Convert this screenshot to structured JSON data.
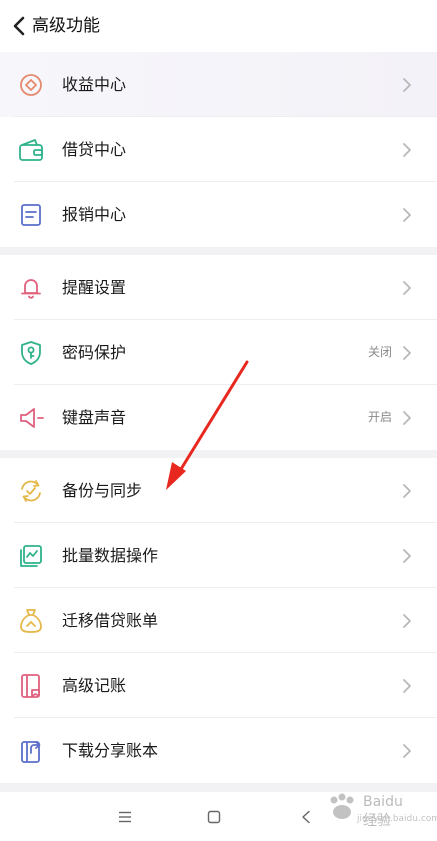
{
  "header": {
    "title": "高级功能",
    "back_icon": "chevron-left-icon"
  },
  "groups": [
    {
      "items": [
        {
          "label": "收益中心",
          "icon": "income-icon",
          "color": "#e58a6e",
          "status": ""
        },
        {
          "label": "借贷中心",
          "icon": "wallet-icon",
          "color": "#2fb28a",
          "status": ""
        },
        {
          "label": "报销中心",
          "icon": "receipt-icon",
          "color": "#5c6fc9",
          "status": ""
        }
      ]
    },
    {
      "items": [
        {
          "label": "提醒设置",
          "icon": "bell-icon",
          "color": "#e0607e",
          "status": ""
        },
        {
          "label": "密码保护",
          "icon": "shield-key-icon",
          "color": "#2fb28a",
          "status": "关闭"
        },
        {
          "label": "键盘声音",
          "icon": "speaker-icon",
          "color": "#e0607e",
          "status": "开启"
        }
      ]
    },
    {
      "items": [
        {
          "label": "备份与同步",
          "icon": "sync-check-icon",
          "color": "#e5b84a",
          "status": ""
        },
        {
          "label": "批量数据操作",
          "icon": "batch-chart-icon",
          "color": "#2fb28a",
          "status": ""
        },
        {
          "label": "迁移借贷账单",
          "icon": "money-bag-icon",
          "color": "#e5b84a",
          "status": ""
        },
        {
          "label": "高级记账",
          "icon": "ledger-icon",
          "color": "#e0607e",
          "status": ""
        },
        {
          "label": "下载分享账本",
          "icon": "share-book-icon",
          "color": "#5c6fc9",
          "status": ""
        }
      ]
    }
  ],
  "navbar": {
    "menu_icon": "menu-icon",
    "home_icon": "home-square-icon",
    "back_icon": "back-triangle-icon"
  },
  "annotation": {
    "arrow_color": "#e8281f"
  },
  "watermark": {
    "brand": "Baidu",
    "text": "经验",
    "sub": "jingyan.baidu.com"
  }
}
